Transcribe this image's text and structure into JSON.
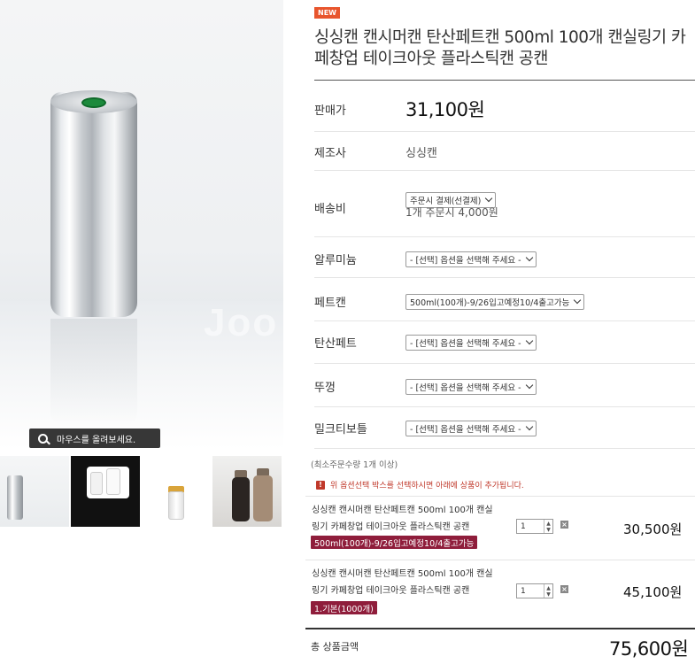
{
  "gallery": {
    "watermark": "Joo",
    "zoom_hint": "마우스를 올려보세요."
  },
  "product": {
    "badge": "NEW",
    "title": "싱싱캔 캔시머캔 탄산페트캔 500ml 100개 캔실링기 카페창업 테이크아웃 플라스틱캔 공캔"
  },
  "details": {
    "price_label": "판매가",
    "price_value": "31,100원",
    "maker_label": "제조사",
    "maker_value": "싱싱캔",
    "shipping_label": "배송비",
    "shipping_select": "주문시 결제(선결제)",
    "shipping_note": "1개 주문시 4,000원"
  },
  "options": [
    {
      "label": "알루미늄",
      "selected": "- [선택] 옵션을 선택해 주세요 -"
    },
    {
      "label": "페트캔",
      "selected": "500ml(100개)-9/26입고예정10/4출고가능"
    },
    {
      "label": "탄산페트",
      "selected": "- [선택] 옵션을 선택해 주세요 -"
    },
    {
      "label": "뚜껑",
      "selected": "- [선택] 옵션을 선택해 주세요 -"
    },
    {
      "label": "밀크티보틀",
      "selected": "- [선택] 옵션을 선택해 주세요 -"
    }
  ],
  "notes": {
    "min_order": "(최소주문수량 1개 이상)",
    "alert_icon": "!",
    "alert_text": "위 옵션선택 박스를 선택하시면 아래에 상품이 추가됩니다."
  },
  "cart_items": [
    {
      "name_line1": "싱싱캔 캔시머캔 탄산페트캔 500ml 100개 캔실",
      "name_line2": "링기 카페창업 테이크아웃 플라스틱캔 공캔",
      "option": "500ml(100개)-9/26입고예정10/4출고가능",
      "qty": "1",
      "amount": "30,500원"
    },
    {
      "name_line1": "싱싱캔 캔시머캔 탄산페트캔 500ml 100개 캔실",
      "name_line2": "링기 카페창업 테이크아웃 플라스틱캔 공캔",
      "option": "1.기본(1000개)",
      "qty": "1",
      "amount": "45,100원"
    }
  ],
  "total": {
    "label": "총 상품금액",
    "value": "75,600원"
  },
  "icons": {
    "arrow_up": "▲",
    "arrow_down": "▼",
    "delete": "×"
  }
}
